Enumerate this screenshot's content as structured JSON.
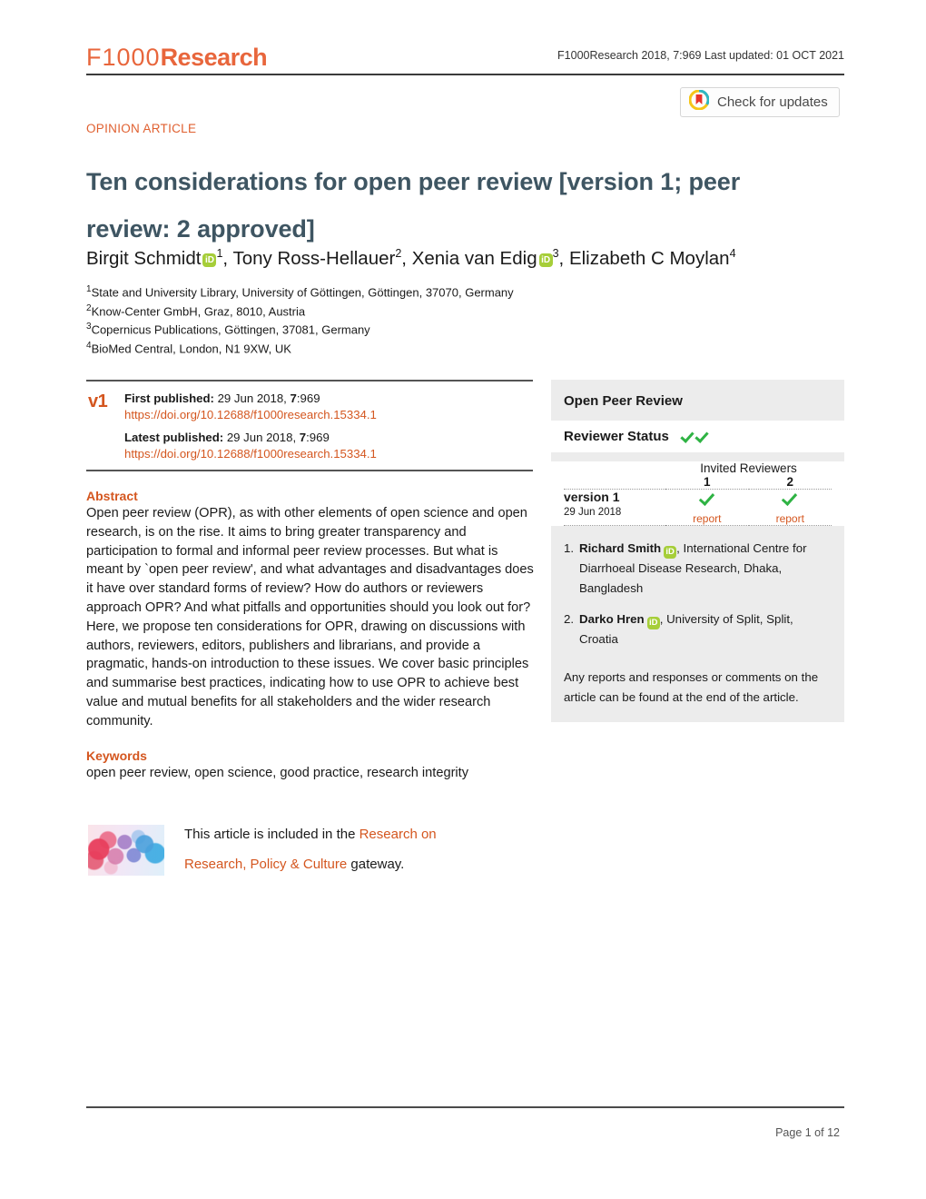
{
  "header": {
    "logo_light": "F1000",
    "logo_bold": "Research",
    "meta": "F1000Research 2018, 7:969 Last updated: 01 OCT 2021",
    "crossmark_label": "Check for updates",
    "crossmark_icon": "crossmark-circle-icon"
  },
  "article": {
    "kicker": "OPINION ARTICLE",
    "title_line1": "Ten considerations for open peer review",
    "title_bracket1": "[version 1; peer",
    "title_line2": "review: 2 approved]",
    "authors": [
      {
        "name": "Birgit Schmidt",
        "orcid": true,
        "sup": "1",
        "sep": ", "
      },
      {
        "name": "Tony Ross-Hellauer",
        "orcid": false,
        "sup": "2",
        "sep": ", "
      },
      {
        "name": "Xenia van Edig",
        "orcid": true,
        "sup": "3",
        "sep": ", "
      },
      {
        "name": "Elizabeth C Moylan",
        "orcid": false,
        "sup": "4",
        "sep": ""
      }
    ],
    "affiliations": [
      {
        "sup": "1",
        "text": "State and University Library, University of Göttingen, Göttingen, 37070, Germany"
      },
      {
        "sup": "2",
        "text": "Know-Center GmbH, Graz, 8010, Austria"
      },
      {
        "sup": "3",
        "text": "Copernicus Publications, Göttingen, 37081, Germany"
      },
      {
        "sup": "4",
        "text": "BioMed Central, London, N1 9XW, UK"
      }
    ]
  },
  "version_block": {
    "version_badge": "v1",
    "first_published_label": "First published:",
    "first_published_value": "29 Jun 2018, ",
    "first_published_volume": "7",
    "first_published_page": ":969",
    "first_doi": "https://doi.org/10.12688/f1000research.15334.1",
    "latest_published_label": "Latest published:",
    "latest_published_value": "29 Jun 2018, ",
    "latest_published_volume": "7",
    "latest_published_page": ":969",
    "latest_doi": "https://doi.org/10.12688/f1000research.15334.1"
  },
  "abstract": {
    "heading": "Abstract",
    "body": "Open peer review (OPR), as with other elements of open science and open research, is on the rise. It aims to bring greater transparency and participation to formal and informal peer review processes. But what is meant by `open peer review', and what advantages and disadvantages does it have over standard forms of review? How do authors or reviewers approach OPR? And what pitfalls and opportunities should you look out for? Here, we propose ten considerations for OPR, drawing on discussions with authors, reviewers, editors, publishers and librarians, and provide a pragmatic, hands-on introduction to these issues. We cover basic principles and summarise best practices, indicating how to use OPR to achieve best value and mutual benefits for all stakeholders and the wider research community."
  },
  "keywords": {
    "heading": "Keywords",
    "body": "open peer review, open science, good practice, research integrity"
  },
  "open_peer_review": {
    "title": "Open Peer Review",
    "reviewer_status_label": "Reviewer Status",
    "status_checks": 2,
    "invited_reviewers_label": "Invited Reviewers",
    "columns": [
      "1",
      "2"
    ],
    "version_name": "version 1",
    "version_date": "29 Jun 2018",
    "report_links": [
      "report",
      "report"
    ],
    "reviewers": [
      {
        "num": "1.",
        "name": "Richard Smith",
        "orcid": true,
        "affiliation": ", International Centre for Diarrhoeal Disease Research, Dhaka, Bangladesh"
      },
      {
        "num": "2.",
        "name": "Darko Hren",
        "orcid": true,
        "affiliation": ", University of Split, Split, Croatia"
      }
    ],
    "note": "Any reports and responses or comments on the article can be found at the end of the article."
  },
  "gateway": {
    "prefix": "This article is included in the ",
    "link_part1": "Research on",
    "link_part2": "Research, Policy & Culture",
    "suffix": " gateway.",
    "image_name": "gateway-thumbnail"
  },
  "footer": {
    "page_label": "Page 1 of 12"
  },
  "colors": {
    "brand_orange": "#e8663c",
    "link_orange": "#d4561f",
    "title_slate": "#3e5562",
    "check_green": "#2fb344",
    "orcid_green": "#a6ce39",
    "panel_gray": "#ececec"
  }
}
